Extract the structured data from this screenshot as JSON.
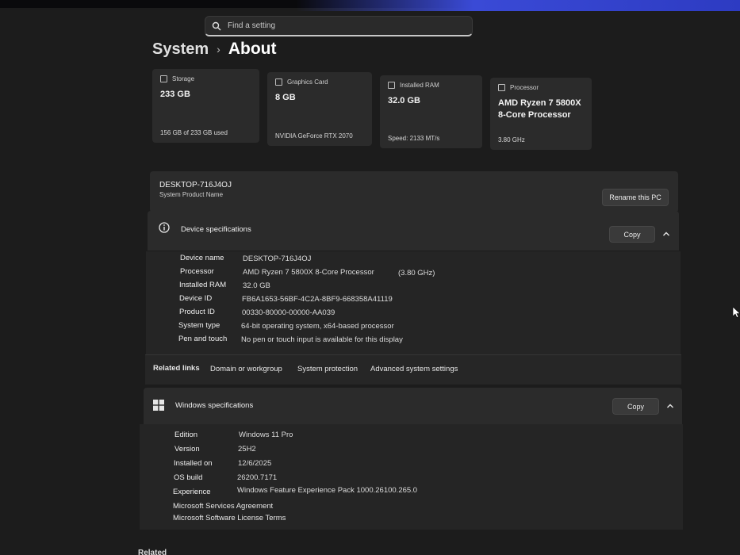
{
  "search": {
    "placeholder": "Find a setting"
  },
  "breadcrumb": {
    "parent": "System",
    "separator": "›",
    "current": "About"
  },
  "cards": [
    {
      "title": "Storage",
      "value": "233 GB",
      "sub": "156 GB of 233 GB used"
    },
    {
      "title": "Graphics Card",
      "value": "8 GB",
      "sub": "NVIDIA GeForce RTX 2070"
    },
    {
      "title": "Installed RAM",
      "value": "32.0 GB",
      "sub": "Speed: 2133 MT/s"
    },
    {
      "title": "Processor",
      "value": "AMD Ryzen 7 5800X\n8-Core Processor",
      "sub": "3.80 GHz"
    }
  ],
  "pc": {
    "name": "DESKTOP-716J4OJ",
    "subtitle": "System Product Name",
    "rename_label": "Rename this PC"
  },
  "device_specs": {
    "title": "Device specifications",
    "copy_label": "Copy",
    "rows": [
      {
        "label": "Device name",
        "value": "DESKTOP-716J4OJ"
      },
      {
        "label": "Processor",
        "value": "AMD Ryzen 7 5800X 8-Core Processor",
        "extra": "(3.80 GHz)"
      },
      {
        "label": "Installed RAM",
        "value": "32.0 GB"
      },
      {
        "label": "Device ID",
        "value": "FB6A1653-56BF-4C2A-8BF9-668358A41119"
      },
      {
        "label": "Product ID",
        "value": "00330-80000-00000-AA039"
      },
      {
        "label": "System type",
        "value": "64-bit operating system, x64-based processor"
      },
      {
        "label": "Pen and touch",
        "value": "No pen or touch input is available for this display"
      }
    ]
  },
  "related_links": {
    "label": "Related links",
    "links": [
      "Domain or workgroup",
      "System protection",
      "Advanced system settings"
    ]
  },
  "windows_specs": {
    "title": "Windows specifications",
    "copy_label": "Copy",
    "rows": [
      {
        "label": "Edition",
        "value": "Windows 11 Pro"
      },
      {
        "label": "Version",
        "value": "25H2"
      },
      {
        "label": "Installed on",
        "value": "12/6/2025"
      },
      {
        "label": "OS build",
        "value": "26200.7171"
      },
      {
        "label": "Experience",
        "value": "Windows Feature Experience Pack 1000.26100.265.0"
      }
    ],
    "links": [
      "Microsoft Services Agreement",
      "Microsoft Software License Terms"
    ]
  },
  "footer": {
    "related": "Related"
  }
}
